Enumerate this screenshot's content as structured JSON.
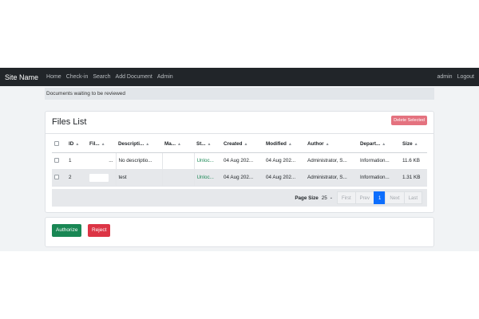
{
  "nav": {
    "brand": "Site Name",
    "links": [
      "Home",
      "Check-in",
      "Search",
      "Add Document",
      "Admin"
    ],
    "right": [
      "admin",
      "Logout"
    ]
  },
  "notice": "Documents waiting to be reviewed",
  "files": {
    "title": "Files List",
    "delete_label": "Delete Selected",
    "columns": [
      "ID",
      "Fil...",
      "Descripti...",
      "Ma...",
      "St...",
      "Created",
      "Modified",
      "Author",
      "Depart...",
      "Size"
    ],
    "rows": [
      {
        "id": "1",
        "file": "...",
        "description": "No descriptio...",
        "ma": "",
        "status": "Unloc...",
        "created": "04 Aug 202...",
        "modified": "04 Aug 202...",
        "author": "Administrator, S...",
        "department": "Information...",
        "size": "11.6 KB"
      },
      {
        "id": "2",
        "file": "",
        "description": "test",
        "ma": "",
        "status": "Unloc...",
        "created": "04 Aug 202...",
        "modified": "04 Aug 202...",
        "author": "Administrator, S...",
        "department": "Information...",
        "size": "1.31 KB"
      }
    ],
    "pager": {
      "page_size_label": "Page Size",
      "page_size": "25",
      "first": "First",
      "prev": "Prev",
      "current": "1",
      "next": "Next",
      "last": "Last"
    }
  },
  "actions": {
    "authorize": "Authorize",
    "reject": "Reject"
  },
  "colors": {
    "navbar": "#212529",
    "success": "#198754",
    "danger": "#dc3545",
    "primary": "#0d6efd"
  }
}
